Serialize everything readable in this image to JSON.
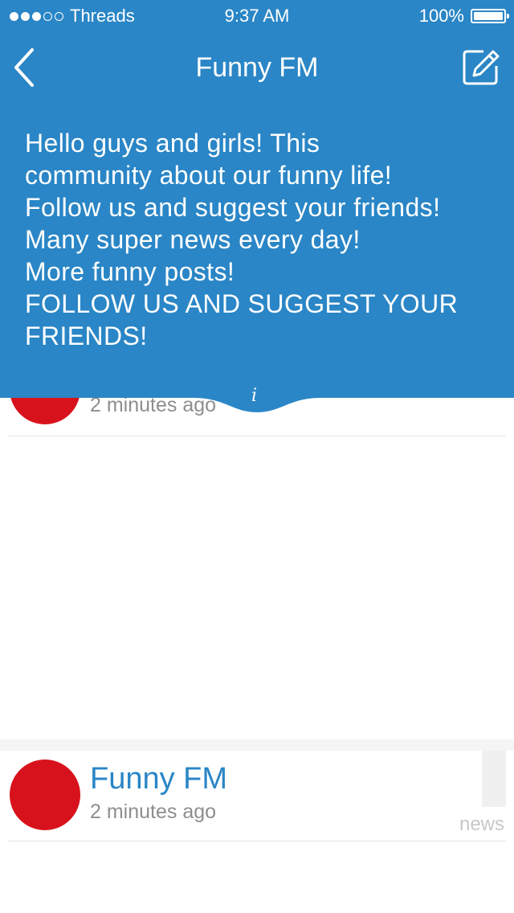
{
  "status_bar": {
    "carrier": "Threads",
    "time": "9:37 AM",
    "battery": "100%",
    "signal_bars": 3
  },
  "nav": {
    "title": "Funny FM",
    "back_icon": "chevron-left-icon",
    "compose_icon": "compose-icon"
  },
  "description": {
    "text": "Hello guys and girls! This\ncommunity about our funny life!\nFollow us and suggest your friends!\nMany super news every day!\nMore funny posts!\nFOLLOW US AND SUGGEST YOUR\nFRIENDS!"
  },
  "feed": {
    "items": [
      {
        "author": "",
        "time": "2 minutes ago",
        "avatar_color": "#d8121c"
      },
      {
        "author": "Funny FM",
        "time": "2 minutes ago",
        "tag": "news",
        "avatar_color": "#d8121c"
      }
    ]
  },
  "colors": {
    "brand": "#2a86c6",
    "avatar": "#d8121c"
  }
}
